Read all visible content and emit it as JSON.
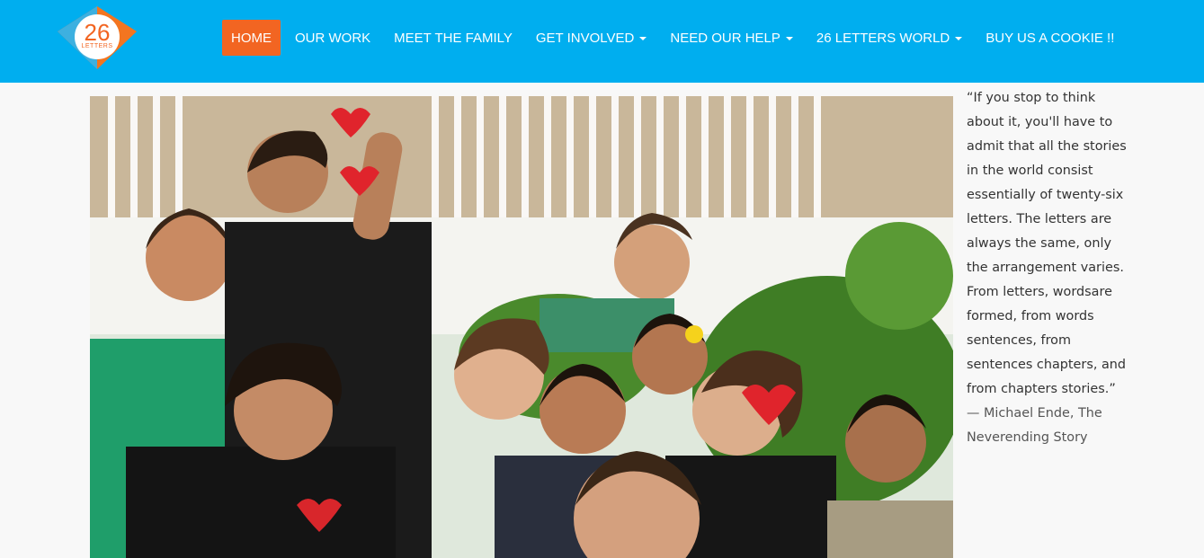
{
  "logo": {
    "number": "26",
    "word": "LETTERS"
  },
  "nav": {
    "items": [
      {
        "label": "HOME",
        "active": true,
        "dropdown": false
      },
      {
        "label": "OUR WORK",
        "active": false,
        "dropdown": false
      },
      {
        "label": "MEET THE FAMILY",
        "active": false,
        "dropdown": false
      },
      {
        "label": "GET INVOLVED",
        "active": false,
        "dropdown": true
      },
      {
        "label": "NEED OUR HELP",
        "active": false,
        "dropdown": true
      },
      {
        "label": "26 LETTERS WORLD",
        "active": false,
        "dropdown": true
      },
      {
        "label": "BUY US A COOKIE !!",
        "active": false,
        "dropdown": false
      }
    ]
  },
  "quote": {
    "text": "“If you stop to think about it, you'll have to admit that all the stories in the world consist essentially of twenty-six letters. The letters are always the same, only the arrangement varies. From letters, wordsare formed, from words sentences, from sentences chapters, and from chapters stories.”",
    "attribution": "— Michael Ende, The Neverending Story"
  },
  "colors": {
    "navbar": "#00aeef",
    "accent": "#f26522",
    "page_background": "#f8f8f8"
  }
}
